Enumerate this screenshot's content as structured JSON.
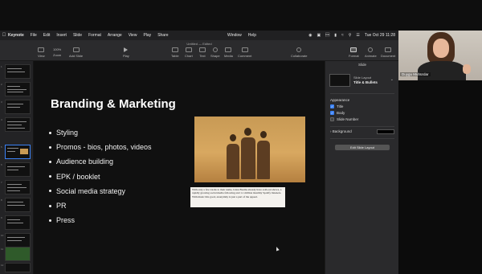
{
  "menubar": {
    "app_name": "Keynote",
    "items": [
      "File",
      "Edit",
      "Insert",
      "Slide",
      "Format",
      "Arrange",
      "View",
      "Play",
      "Share"
    ],
    "center_items": [
      "Window",
      "Help"
    ],
    "clock": "Tue Oct 29  11:28"
  },
  "toolbar": {
    "doc_title": "Untitled — Edited",
    "left": [
      {
        "label": "View"
      },
      {
        "label": "Zoom",
        "value": "100%"
      },
      {
        "label": "Add Slide"
      }
    ],
    "play_label": "Play",
    "insert": [
      {
        "label": "Table"
      },
      {
        "label": "Chart"
      },
      {
        "label": "Text"
      },
      {
        "label": "Shape"
      },
      {
        "label": "Media"
      },
      {
        "label": "Comment"
      }
    ],
    "collaborate_label": "Collaborate",
    "right": [
      {
        "label": "Format"
      },
      {
        "label": "Animate"
      },
      {
        "label": "Document"
      }
    ]
  },
  "slide": {
    "title": "Branding & Marketing",
    "bullets": [
      "Styling",
      "Promos - bios, photos, videos",
      "Audience building",
      "EPK / booklet",
      "Social media strategy",
      "PR",
      "Press"
    ],
    "caption": "With only a few tracks to their name, Glass Beams already have sold-out shows, a rapidly growing social media following and 1.1 million monthly Spotify listeners. With music this good, anonymity is just a part of the appeal."
  },
  "inspector": {
    "title": "Slide",
    "layout_label": "Slide Layout",
    "layout_value": "Title & Bullets",
    "appearance_label": "Appearance",
    "checkboxes": [
      {
        "label": "Title",
        "checked": true
      },
      {
        "label": "Body",
        "checked": true
      },
      {
        "label": "Slide Number",
        "checked": false
      }
    ],
    "background_label": "Background",
    "background_color": "#000000",
    "edit_button": "Edit Slide Layout"
  },
  "webcam": {
    "name": "Duygu Muhürdar"
  },
  "colors": {
    "selection": "#3b82f6",
    "slide_bg": "#101010"
  }
}
